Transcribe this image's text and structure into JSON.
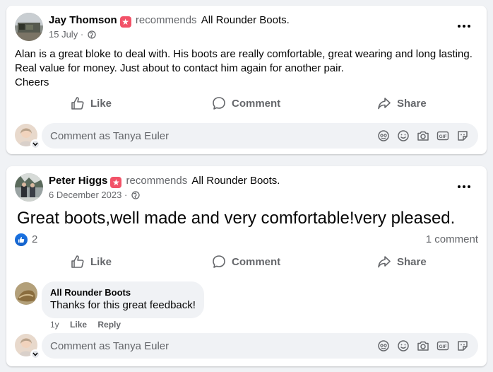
{
  "posts": [
    {
      "author": "Jay Thomson",
      "verb": "recommends",
      "page": "All Rounder Boots.",
      "date": "15 July",
      "text": [
        "Alan is a great bloke to deal with. His boots are really comfortable, great wearing and long lasting.",
        "Real value for money. Just about to contact him again for another pair.",
        "Cheers"
      ],
      "actions": {
        "like": "Like",
        "comment": "Comment",
        "share": "Share"
      },
      "comment_placeholder": "Comment as Tanya Euler"
    },
    {
      "author": "Peter Higgs",
      "verb": "recommends",
      "page": "All Rounder Boots.",
      "date": "6 December 2023",
      "text": "Great boots,well made and very comfortable!very pleased.",
      "reaction_count": "2",
      "comment_count": "1 comment",
      "actions": {
        "like": "Like",
        "comment": "Comment",
        "share": "Share"
      },
      "reply": {
        "author": "All Rounder Boots",
        "text": "Thanks for this great feedback!",
        "age": "1y",
        "like": "Like",
        "reply": "Reply"
      },
      "comment_placeholder": "Comment as Tanya Euler"
    }
  ],
  "date_separator": " · ",
  "colors": {
    "like_blue": "#1b74e4",
    "recommend_badge": "#f25268",
    "secondary_text": "#65676b"
  }
}
